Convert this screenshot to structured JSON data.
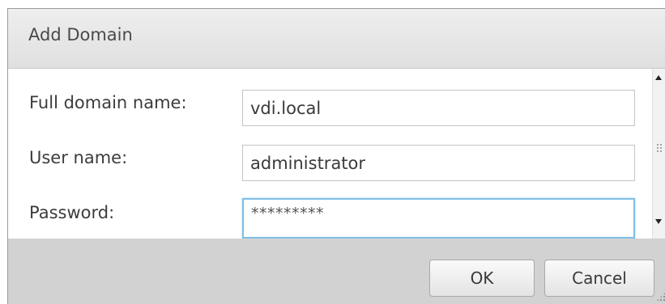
{
  "dialog": {
    "title": "Add Domain"
  },
  "form": {
    "domain_label": "Full domain name:",
    "domain_value": "vdi.local",
    "user_label": "User name:",
    "user_value": "administrator",
    "password_label": "Password:",
    "password_value": "*********"
  },
  "buttons": {
    "ok_label": "OK",
    "cancel_label": "Cancel"
  },
  "icons": {
    "scroll_up": "scroll-up-arrow-icon",
    "scroll_down": "scroll-down-arrow-icon",
    "resize": "resize-grip-icon"
  },
  "colors": {
    "focus_border": "#7fbfe6",
    "footer_bg": "#d2d2d2",
    "title_bg": "#e6e6e6"
  }
}
